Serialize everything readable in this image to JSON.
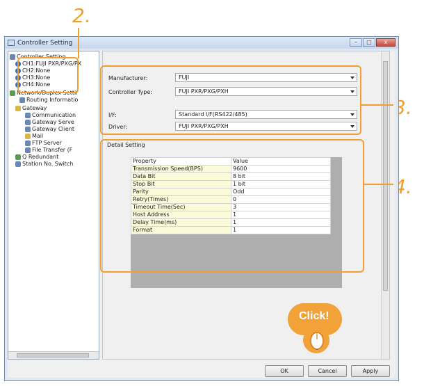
{
  "window": {
    "title": "Controller Setting",
    "controls": [
      "–",
      "□",
      "x"
    ]
  },
  "tree": {
    "items": [
      {
        "label": "Controller Setting"
      },
      {
        "label": "CH1:FUJI PXR/PXG/PX"
      },
      {
        "label": "CH2:None"
      },
      {
        "label": "CH3:None"
      },
      {
        "label": "CH4:None"
      },
      {
        "label": "Network/Duplex Settir"
      },
      {
        "label": "Routing Informatio"
      },
      {
        "label": "Gateway"
      },
      {
        "label": "Communication"
      },
      {
        "label": "Gateway Serve"
      },
      {
        "label": "Gateway Client"
      },
      {
        "label": "Mail"
      },
      {
        "label": "FTP Server"
      },
      {
        "label": "File Transfer (F"
      },
      {
        "label": "Q Redundant"
      },
      {
        "label": "Station No. Switch"
      }
    ]
  },
  "settings": {
    "manufacturer_label": "Manufacturer:",
    "manufacturer_value": "FUJI",
    "controller_type_label": "Controller Type:",
    "controller_type_value": "FUJI PXR/PXG/PXH",
    "if_label": "I/F:",
    "if_value": "Standard I/F(RS422/485)",
    "driver_label": "Driver:",
    "driver_value": "FUJI PXR/PXG/PXH"
  },
  "detail": {
    "label": "Detail Setting",
    "headers": [
      "Property",
      "Value"
    ],
    "rows": [
      {
        "property": "Transmission Speed(BPS)",
        "value": "9600"
      },
      {
        "property": "Data Bit",
        "value": "8 bit"
      },
      {
        "property": "Stop Bit",
        "value": "1 bit"
      },
      {
        "property": "Parity",
        "value": "Odd"
      },
      {
        "property": "Retry(Times)",
        "value": "0"
      },
      {
        "property": "Timeout Time(Sec)",
        "value": "3"
      },
      {
        "property": "Host Address",
        "value": "1"
      },
      {
        "property": "Delay Time(ms)",
        "value": "1"
      },
      {
        "property": "Format",
        "value": "1"
      }
    ]
  },
  "buttons": {
    "ok": "OK",
    "cancel": "Cancel",
    "apply": "Apply"
  },
  "annotations": {
    "marker2": "2.",
    "marker3": "3.",
    "marker4": "4.",
    "click": "Click!",
    "accent_color": "#f0a030"
  }
}
